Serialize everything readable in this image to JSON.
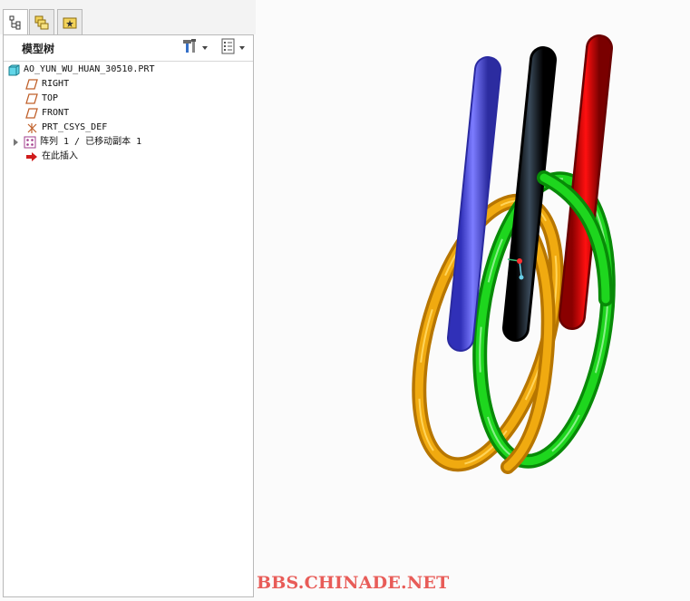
{
  "panel": {
    "title": "模型树",
    "tabs": [
      {
        "icon": "model-tree-icon"
      },
      {
        "icon": "folder-browser-icon"
      },
      {
        "icon": "favorites-icon"
      }
    ],
    "header_buttons": [
      {
        "icon": "settings-tools-icon"
      },
      {
        "icon": "show-list-icon"
      }
    ]
  },
  "tree": {
    "root": "AO_YUN_WU_HUAN_30510.PRT",
    "items": [
      {
        "label": "RIGHT",
        "icon": "datum-plane-icon"
      },
      {
        "label": "TOP",
        "icon": "datum-plane-icon"
      },
      {
        "label": "FRONT",
        "icon": "datum-plane-icon"
      },
      {
        "label": "PRT_CSYS_DEF",
        "icon": "coordinate-system-icon"
      },
      {
        "label": "阵列 1 / 已移动副本 1",
        "icon": "pattern-icon"
      },
      {
        "label": "在此插入",
        "icon": "insert-here-arrow-icon"
      }
    ]
  },
  "viewport": {
    "rings": [
      {
        "name": "blue",
        "color": "#5555e6"
      },
      {
        "name": "black",
        "color": "#101010"
      },
      {
        "name": "red",
        "color": "#d80000"
      },
      {
        "name": "yellow",
        "color": "#e8a100"
      },
      {
        "name": "green",
        "color": "#14c414"
      }
    ]
  },
  "watermark": "BBS.CHINADE.NET"
}
